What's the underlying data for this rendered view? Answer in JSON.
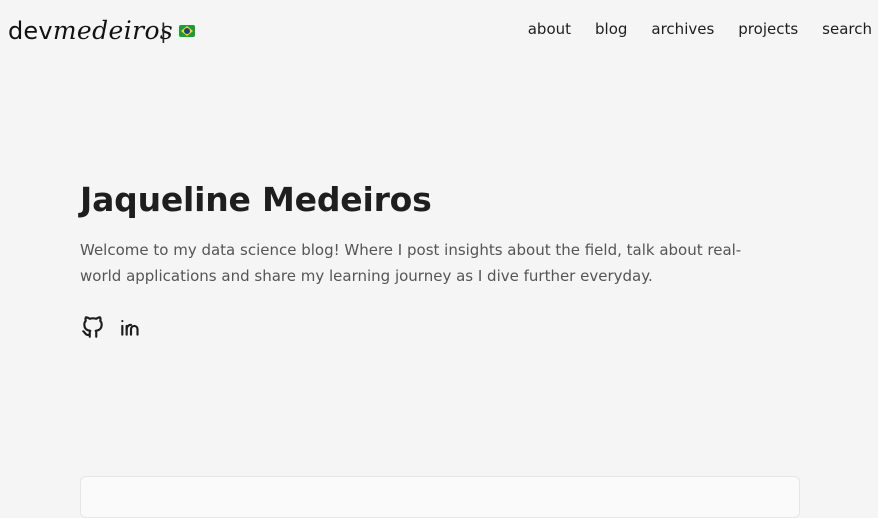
{
  "header": {
    "logo_prefix": "dev",
    "logo_suffix": "medeiros",
    "divider": "|",
    "language_flag": "brazil-flag-icon"
  },
  "nav": {
    "items": [
      {
        "label": "about"
      },
      {
        "label": "blog"
      },
      {
        "label": "archives"
      },
      {
        "label": "projects"
      },
      {
        "label": "search"
      }
    ]
  },
  "profile": {
    "name": "Jaqueline Medeiros",
    "intro": "Welcome to my data science blog! Where I post insights about the field, talk about real-world applications and share my learning journey as I dive further everyday.",
    "social": [
      {
        "icon": "github-icon"
      },
      {
        "icon": "linkedin-icon"
      }
    ]
  },
  "colors": {
    "background": "#f5f5f5",
    "text": "#1e1e1e",
    "muted_text": "#555555"
  }
}
